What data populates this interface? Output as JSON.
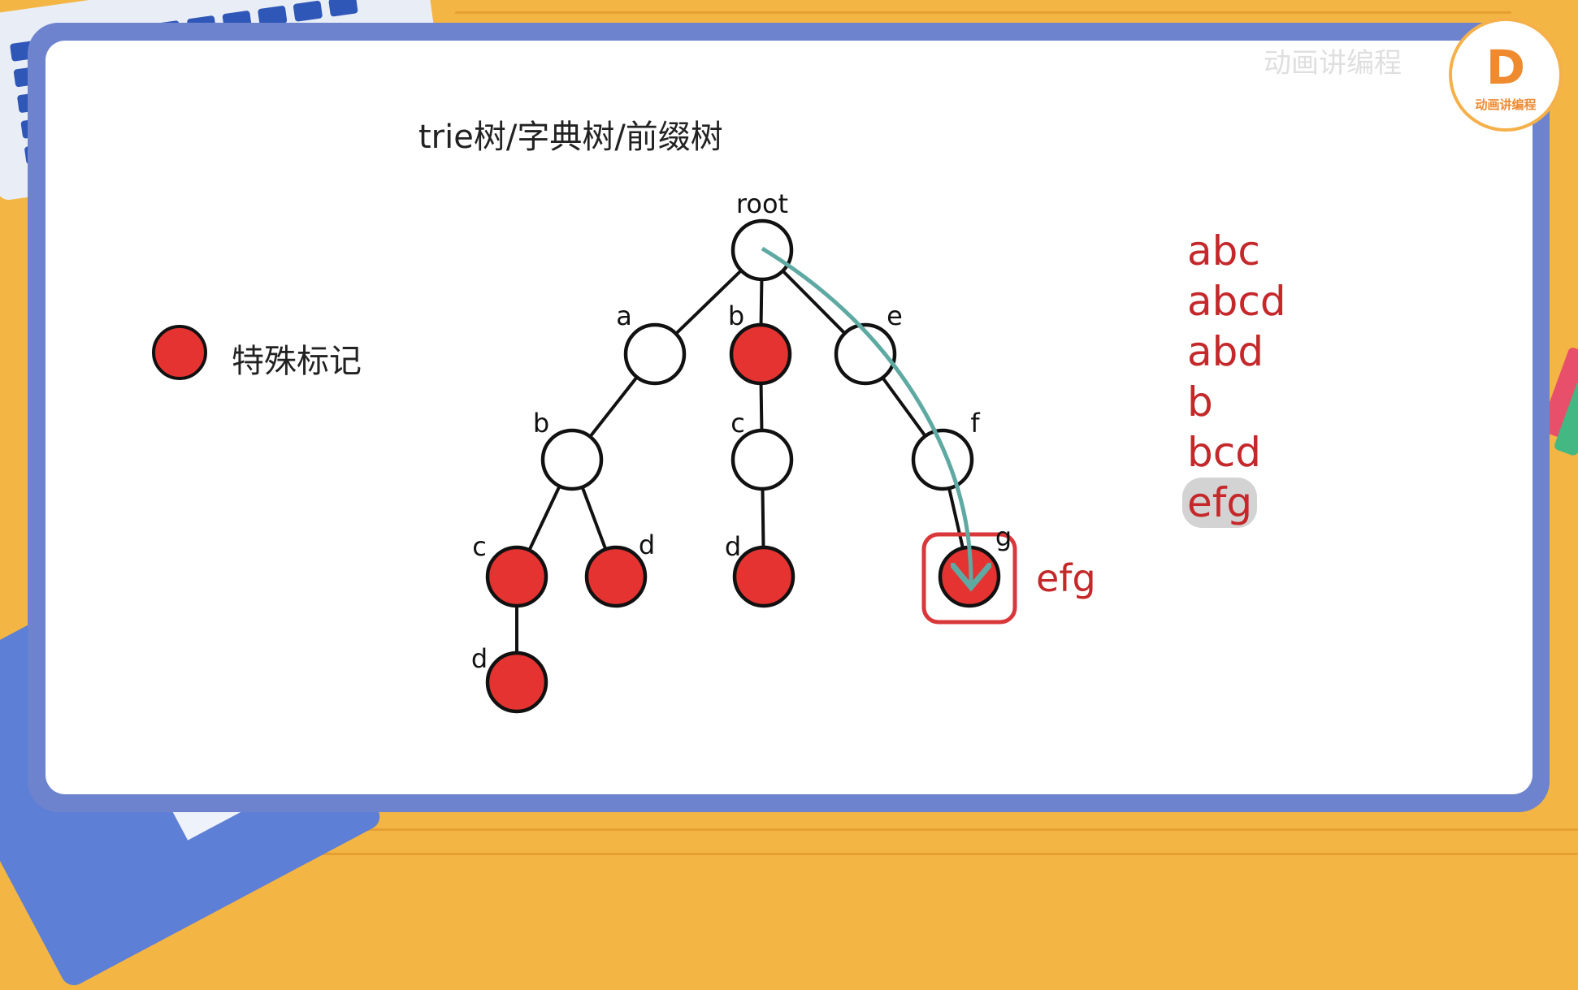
{
  "title": "trie树/字典树/前缀树",
  "legend": {
    "label": "特殊标记",
    "marker_color": "#e53331"
  },
  "tree": {
    "root_label": "root",
    "nodes": [
      {
        "id": "root",
        "label": "root",
        "marked": false
      },
      {
        "id": "a",
        "label": "a",
        "parent": "root",
        "marked": false
      },
      {
        "id": "b1",
        "label": "b",
        "parent": "root",
        "marked": true
      },
      {
        "id": "e",
        "label": "e",
        "parent": "root",
        "marked": false
      },
      {
        "id": "ab",
        "label": "b",
        "parent": "a",
        "marked": false
      },
      {
        "id": "abc",
        "label": "c",
        "parent": "ab",
        "marked": true
      },
      {
        "id": "abd",
        "label": "d",
        "parent": "ab",
        "marked": true
      },
      {
        "id": "abcd",
        "label": "d",
        "parent": "abc",
        "marked": true
      },
      {
        "id": "bc",
        "label": "c",
        "parent": "b1",
        "marked": false
      },
      {
        "id": "bcd",
        "label": "d",
        "parent": "bc",
        "marked": true
      },
      {
        "id": "ef",
        "label": "f",
        "parent": "e",
        "marked": false
      },
      {
        "id": "efg",
        "label": "g",
        "parent": "ef",
        "marked": true
      }
    ],
    "highlight_node": "efg",
    "highlight_label": "efg",
    "path_arrow_color": "#5fa9a3",
    "marked_color": "#e53331"
  },
  "words": [
    "abc",
    "abcd",
    "abd",
    "b",
    "bcd",
    "efg"
  ],
  "highlighted_word": "efg",
  "logo": {
    "mark": "D",
    "text": "动画讲编程"
  },
  "watermark": "动画讲编程"
}
